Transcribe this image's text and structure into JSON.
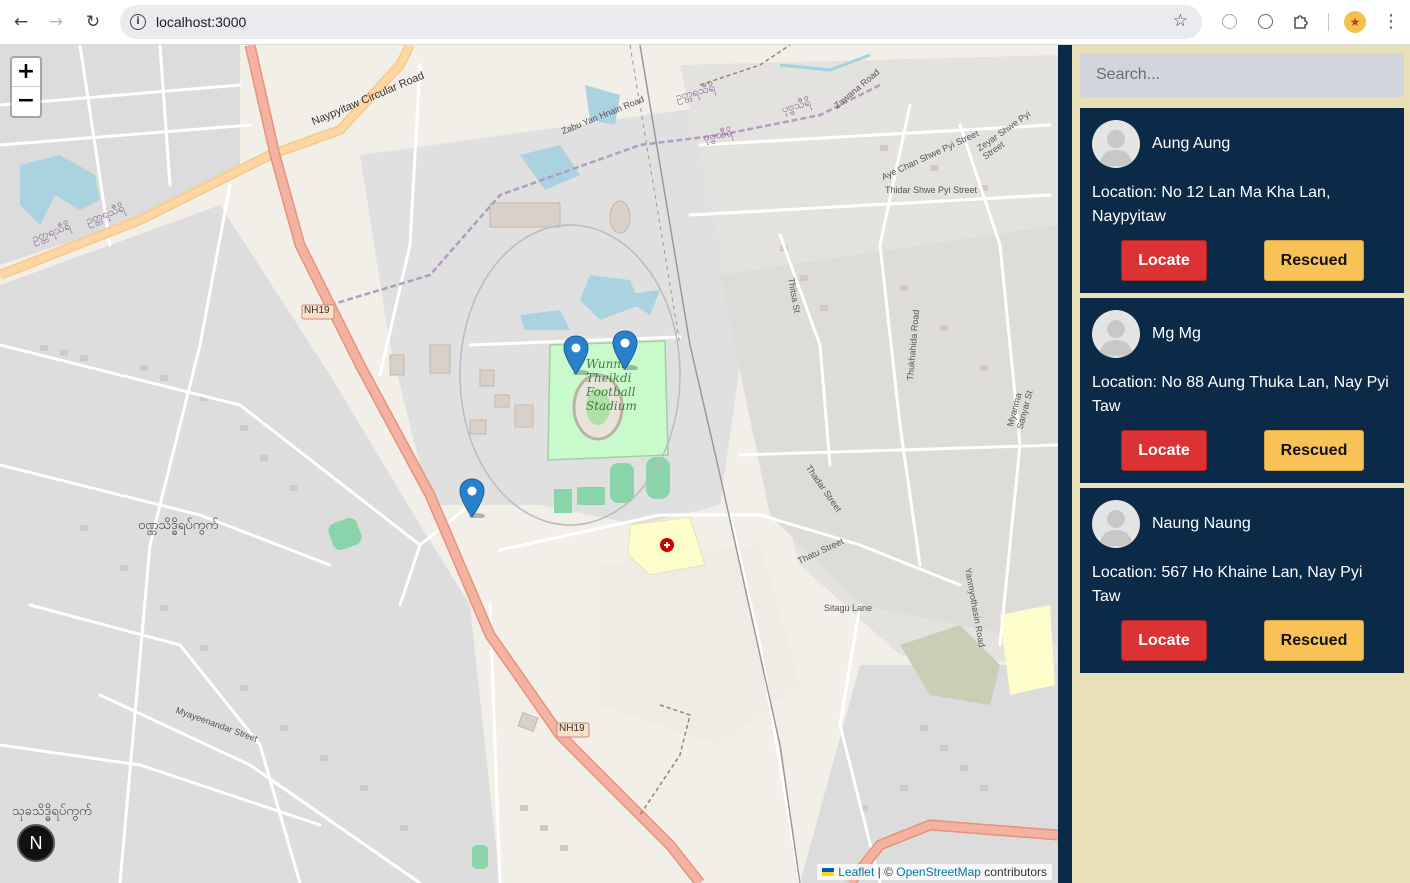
{
  "browser": {
    "url": "localhost:3000",
    "icons": [
      "back-arrow-icon",
      "forward-arrow-icon",
      "reload-icon",
      "site-info-icon",
      "bookmark-star-icon",
      "extension-icon",
      "puzzle-extensions-icon",
      "profile-icon",
      "more-menu-icon"
    ]
  },
  "map": {
    "zoom_in_label": "+",
    "zoom_out_label": "−",
    "labels": {
      "stadium": "Wunna Theikdi Football Stadium",
      "road_circular": "Naypyitaw Circular Road",
      "road_nh19_a": "NH19",
      "road_nh19_b": "NH19",
      "road_zabu": "Zabu Yan Hnain Road",
      "road_zawana": "Zawana Road",
      "road_thidar_shwe": "Thidar Shwe Pyi Street",
      "road_aye_chan": "Aye Chan Shwe Pyi Street",
      "road_zeyar": "Zeyar Shwe Pyi Street",
      "road_thukhahida": "Thukhahida Road",
      "road_thadar": "Thadar Street",
      "road_thitsa": "Thitsa St",
      "road_thatu": "Thatu Street",
      "road_sitagu": "Sitagu Lane",
      "road_yanmyo": "Yanmyothasin Road",
      "road_myayeenandar": "Myayeenandar Street",
      "road_myanma_sanyar": "Myanma Sanyar St",
      "burmese_1": "ဝဏ္ဏသိဒ္ဓိရပ်ကွက်",
      "burmese_2": "သုခသိဒ္ဓိရပ်ကွက်",
      "burmese_3": "ဥတ္တရသီရိ",
      "burmese_4": "ဥတ္တရသီရိ",
      "burmese_5": "ဥတ္တရသီရိ",
      "burmese_6": "ပုဗ္ဗသီရိ",
      "burmese_7": "ပုဗ္ဗသီရိ"
    },
    "attribution": {
      "leaflet": "Leaflet",
      "separator": " | © ",
      "osm": "OpenStreetMap",
      "suffix": " contributors"
    },
    "markers": [
      "map-marker-1",
      "map-marker-2",
      "map-marker-3"
    ],
    "next_badge": "N"
  },
  "sidebar": {
    "search_placeholder": "Search...",
    "people": [
      {
        "name": "Aung Aung",
        "location": "Location: No 12 Lan Ma Kha Lan, Naypyitaw",
        "locate_label": "Locate",
        "rescued_label": "Rescued"
      },
      {
        "name": "Mg Mg",
        "location": "Location: No 88 Aung Thuka Lan, Nay Pyi Taw",
        "locate_label": "Locate",
        "rescued_label": "Rescued"
      },
      {
        "name": "Naung Naung",
        "location": "Location: 567 Ho Khaine Lan, Nay Pyi Taw",
        "locate_label": "Locate",
        "rescued_label": "Rescued"
      }
    ]
  },
  "colors": {
    "card_bg": "#0a2a47",
    "sidebar_bg": "#e8e0b7",
    "locate_button": "#dc3234",
    "rescued_button": "#f8c256",
    "marker_blue": "#2a81cb"
  }
}
